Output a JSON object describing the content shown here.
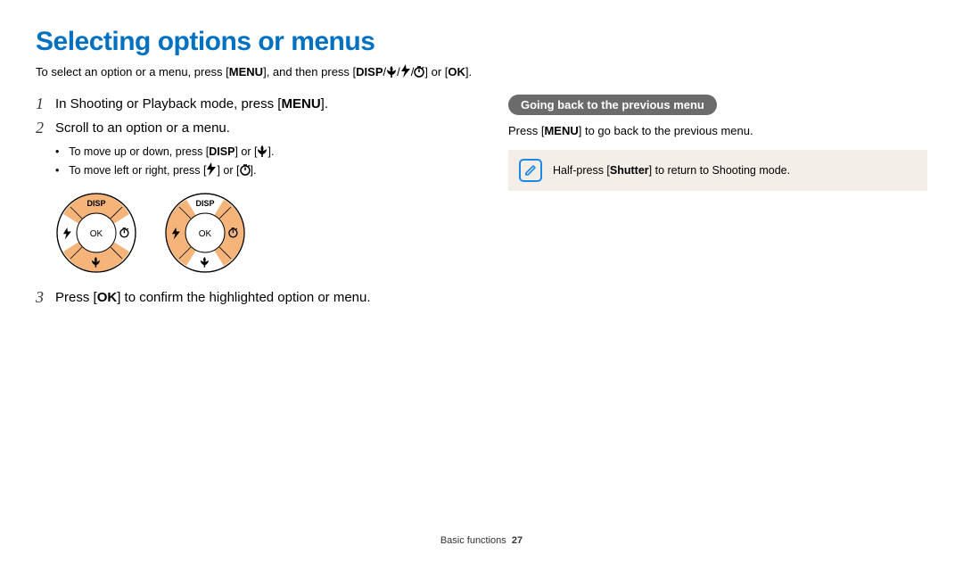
{
  "title": "Selecting options or menus",
  "intro": {
    "pre": "To select an option or a menu, press [",
    "menu": "MENU",
    "mid": "], and then press [",
    "disp": "DISP",
    "or": "] or [",
    "ok": "OK",
    "end": "]."
  },
  "step1": {
    "num": "1",
    "pre": "In Shooting or Playback mode, press [",
    "menu": "MENU",
    "post": "]."
  },
  "step2": {
    "num": "2",
    "text": "Scroll to an option or a menu.",
    "sub_a_pre": "To move up or down, press [",
    "sub_a_disp": "DISP",
    "sub_a_mid": "] or [",
    "sub_a_post": "].",
    "sub_b_pre": "To move left or right, press [",
    "sub_b_mid": "] or [",
    "sub_b_post": "]."
  },
  "step3": {
    "num": "3",
    "pre": "Press [",
    "ok": "OK",
    "post": "] to confirm the highlighted option or menu."
  },
  "dial": {
    "disp": "DISP",
    "ok": "OK"
  },
  "pill": "Going back to the previous menu",
  "right_body": {
    "pre": "Press [",
    "menu": "MENU",
    "post": "] to go back to the previous menu."
  },
  "note": {
    "pre": "Half-press [",
    "shutter": "Shutter",
    "post": "] to return to Shooting mode."
  },
  "footer": {
    "section": "Basic functions",
    "page": "27"
  }
}
